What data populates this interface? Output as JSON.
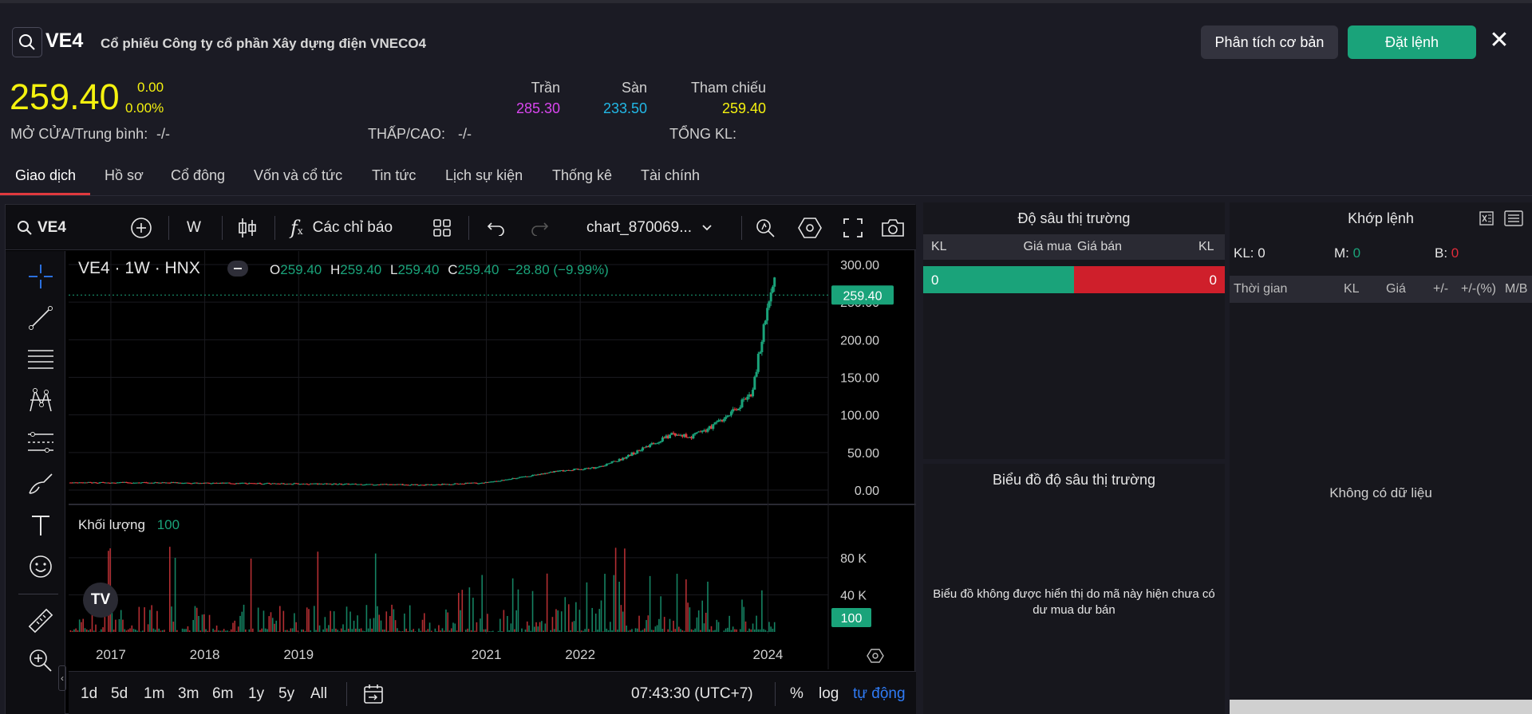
{
  "header": {
    "ticker": "VE4",
    "company": "Cổ phiếu Công ty cổ phần Xây dựng điện VNECO4",
    "analysis_button": "Phân tích cơ bản",
    "order_button": "Đặt lệnh",
    "close_symbol": "✕"
  },
  "quote": {
    "price": "259.40",
    "change": "0.00",
    "change_pct": "0.00%",
    "ceiling_label": "Trần",
    "ceiling": "285.30",
    "floor_label": "Sàn",
    "floor": "233.50",
    "ref_label": "Tham chiếu",
    "ref": "259.40",
    "open_avg_label": "MỞ CỬA/Trung bình:",
    "open_avg": "-/-",
    "low_high_label": "THẤP/CAO:",
    "low_high": "-/-",
    "total_vol_label": "TỔNG KL:",
    "total_vol": "",
    "colors": {
      "price": "#f5f20f",
      "ceiling": "#d946ef",
      "floor": "#22b8e6",
      "ref": "#f5f20f"
    }
  },
  "tabs": [
    "Giao dịch",
    "Hồ sơ",
    "Cổ đông",
    "Vốn và cổ tức",
    "Tin tức",
    "Lịch sự kiện",
    "Thống kê",
    "Tài chính"
  ],
  "active_tab": "Giao dịch",
  "chart_toolbar": {
    "symbol": "VE4",
    "interval": "W",
    "indicators": "Các chỉ báo",
    "layout_name": "chart_870069...",
    "icons": [
      "search-icon",
      "plus-circle-icon",
      "candles-icon",
      "fx-icon",
      "grid-icon",
      "undo-icon",
      "redo-icon",
      "chevron-down-icon",
      "alert-icon",
      "settings-hexagon-icon",
      "fullscreen-icon",
      "camera-icon"
    ]
  },
  "left_tools": [
    "crosshair-icon",
    "trendline-icon",
    "fib-lines-icon",
    "pattern-icon",
    "projection-icon",
    "brush-icon",
    "text-icon",
    "smiley-icon",
    "ruler-icon",
    "zoom-in-icon"
  ],
  "chart_info": {
    "title": "VE4 · 1W · HNX",
    "o_label": "O",
    "o": "259.40",
    "h_label": "H",
    "h": "259.40",
    "l_label": "L",
    "l": "259.40",
    "c_label": "C",
    "c": "259.40",
    "change": "−28.80 (−9.99%)",
    "volume_label": "Khối lượng",
    "volume_value": "100",
    "last_price_tag": "259.40",
    "last_volume_tag": "100",
    "logo": "TV"
  },
  "chart_data": {
    "type": "candlestick",
    "symbol": "VE4",
    "interval": "1W",
    "exchange": "HNX",
    "x_ticks": [
      "2017",
      "2018",
      "2019",
      "2021",
      "2022",
      "2024"
    ],
    "y_ticks": [
      "300.00",
      "250.00",
      "200.00",
      "150.00",
      "100.00",
      "50.00",
      "0.00"
    ],
    "ylim": [
      0,
      300
    ],
    "volume_ticks": [
      "80 K",
      "40 K"
    ],
    "price_path": [
      [
        "2016-08",
        10
      ],
      [
        "2017-06",
        10
      ],
      [
        "2018-06",
        9
      ],
      [
        "2019-06",
        8
      ],
      [
        "2020-06",
        7
      ],
      [
        "2021-01",
        10
      ],
      [
        "2021-06",
        18
      ],
      [
        "2021-10",
        25
      ],
      [
        "2022-03",
        30
      ],
      [
        "2022-06",
        40
      ],
      [
        "2022-10",
        60
      ],
      [
        "2023-01",
        75
      ],
      [
        "2023-03",
        70
      ],
      [
        "2023-06",
        85
      ],
      [
        "2023-09",
        110
      ],
      [
        "2023-11",
        130
      ],
      [
        "2023-12",
        190
      ],
      [
        "2024-01",
        240
      ],
      [
        "2024-02",
        288
      ],
      [
        "2024-02",
        259.4
      ]
    ],
    "last_close": 259.4,
    "last_volume": 100
  },
  "bottom_bar": {
    "ranges": [
      "1d",
      "5d",
      "1m",
      "3m",
      "6m",
      "1y",
      "5y",
      "All"
    ],
    "time": "07:43:30 (UTC+7)",
    "pct": "%",
    "log": "log",
    "auto": "tự động"
  },
  "depth": {
    "title": "Độ sâu thị trường",
    "col_kl1": "KL",
    "col_bid": "Giá mua",
    "col_ask": "Giá bán",
    "col_kl2": "KL",
    "bid_qty": "0",
    "ask_qty": "0",
    "chart_title": "Biểu đồ độ sâu thị trường",
    "chart_empty": "Biểu đồ không được hiển thị do mã này hiện chưa có dư mua dư bán",
    "colors": {
      "bid": "#1aa37a",
      "ask": "#cf1f2b"
    }
  },
  "matches": {
    "title": "Khớp lệnh",
    "kl_label": "KL:",
    "kl": "0",
    "m_label": "M:",
    "m": "0",
    "b_label": "B:",
    "b": "0",
    "cols": [
      "Thời gian",
      "KL",
      "Giá",
      "+/-",
      "+/-(%)",
      "M/B"
    ],
    "empty": "Không có dữ liệu"
  }
}
